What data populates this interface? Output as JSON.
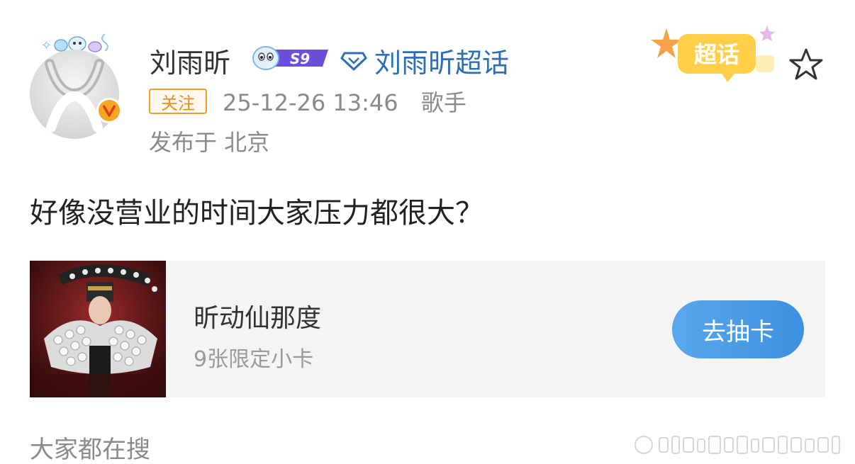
{
  "post": {
    "author": "刘雨昕",
    "level_badge": "S9",
    "supertopic": "刘雨昕超话",
    "follow_label": "关注",
    "timestamp": "25-12-26 13:46",
    "tagline": "歌手",
    "location": "发布于 北京",
    "text": "好像没营业的时间大家压力都很大？",
    "sticker_text": "超话"
  },
  "card": {
    "title": "昕动仙那度",
    "subtitle": "9张限定小卡",
    "button": "去抽卡"
  },
  "footer": {
    "search_label": "大家都在搜"
  },
  "colors": {
    "link_blue": "#2a6fb8",
    "follow_orange": "#f08a24",
    "button_blue": "#4a9ae6",
    "verified_gold": "#f5a623",
    "badge_purple": "#6b4fd8"
  },
  "icons": {
    "verified": "verified-v-icon",
    "supertopic": "diamond-icon",
    "favorite": "star-icon"
  }
}
